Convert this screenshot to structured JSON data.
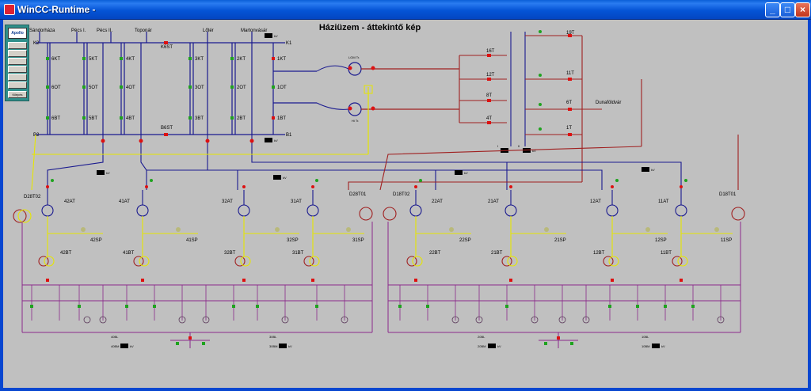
{
  "window": {
    "title": "WinCC-Runtime -",
    "buttons": [
      "_",
      "□",
      "×"
    ]
  },
  "page": {
    "title": "Háziüzem - áttekintő kép"
  },
  "nav": {
    "logo": "Apollo",
    "buttons": [
      "",
      "",
      "",
      "",
      "",
      "",
      "Kilépés"
    ]
  },
  "top_headers": [
    "Sándorháza",
    "Pécs I.",
    "Pécs II.",
    "Toponár",
    "Lőtér",
    "Martonvásár"
  ],
  "bus_labels": {
    "k2": "K2",
    "k1": "K1",
    "b2": "B2",
    "b1": "B1"
  },
  "top_grid": {
    "tie_top": "K6ST",
    "tie_bottom": "B6ST",
    "k_breakers": [
      "6KT",
      "5KT",
      "4KT",
      "3KT",
      "2KT",
      "1KT"
    ],
    "o_breakers": [
      "6OT",
      "5OT",
      "4OT",
      "3OT",
      "2OT",
      "1OT"
    ],
    "b_breakers": [
      "6BT",
      "5BT",
      "4BT",
      "3BT",
      "2BT",
      "1BT"
    ],
    "kv_top": "kV",
    "kv_bottom": "kV"
  },
  "transformers_top": {
    "upper": "LGM Tr.",
    "lower": "Hi Tr."
  },
  "feeder_block": {
    "top_breakers": [
      "16T",
      "12T",
      "8T",
      "4T"
    ],
    "right_breakers": [
      "19T",
      "11T",
      "6T",
      "1T"
    ],
    "outgoing_label": "Dunaföldvár",
    "bus_left": "I",
    "bus_right": "II",
    "kv": "kV"
  },
  "middle_tags": [
    "kV",
    "kV",
    "kV",
    "kV"
  ],
  "sections_row1": {
    "left": [
      "D28T02",
      "42AT",
      "41AT",
      "32AT",
      "31AT",
      "D28T01"
    ],
    "right": [
      "D18T02",
      "22AT",
      "21AT",
      "12AT",
      "11AT",
      "D18T01"
    ]
  },
  "sections_row2": {
    "left": [
      "42BT",
      "42SP",
      "41BT",
      "41SP",
      "32BT",
      "32SP",
      "31BT",
      "31SP"
    ],
    "right": [
      "22BT",
      "22SP",
      "21BT",
      "21SP",
      "12BT",
      "12SP",
      "11BT",
      "11SP"
    ]
  },
  "bottom_labels": {
    "left": [
      "40BL",
      "40BM",
      "30BL",
      "30BM"
    ],
    "right": [
      "20BL",
      "20BM",
      "10BL",
      "10BM"
    ],
    "kv": "kV"
  }
}
